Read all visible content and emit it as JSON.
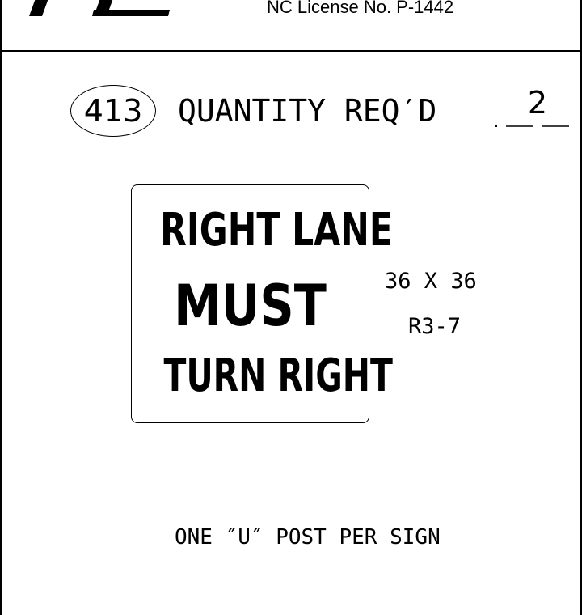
{
  "header": {
    "license": "NC License No. P-1442"
  },
  "sheet": {
    "number": "413",
    "quantity_label": "QUANTITY REQ′D",
    "quantity_value": "2"
  },
  "sign": {
    "lines": [
      "RIGHT LANE",
      "MUST",
      "TURN RIGHT"
    ],
    "size": "36 X 36",
    "code": "R3-7"
  },
  "note": "ONE ″U″ POST PER SIGN"
}
